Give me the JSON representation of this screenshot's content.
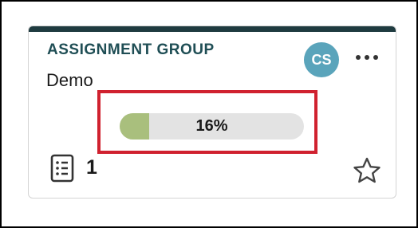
{
  "card": {
    "type_label": "ASSIGNMENT GROUP",
    "name": "Demo",
    "avatar_initials": "CS",
    "progress": {
      "percent": 16,
      "label": "16%"
    },
    "item_count": "1"
  },
  "colors": {
    "topbar": "#1f3b40",
    "type_label": "#1f4e55",
    "avatar": "#5aa4bb",
    "progress_fill": "#a9bf7d",
    "progress_track": "#e3e3e3",
    "highlight": "#d0212f"
  },
  "icons": {
    "more": "more-horizontal-icon",
    "doc": "document-list-icon",
    "star": "star-outline-icon"
  }
}
